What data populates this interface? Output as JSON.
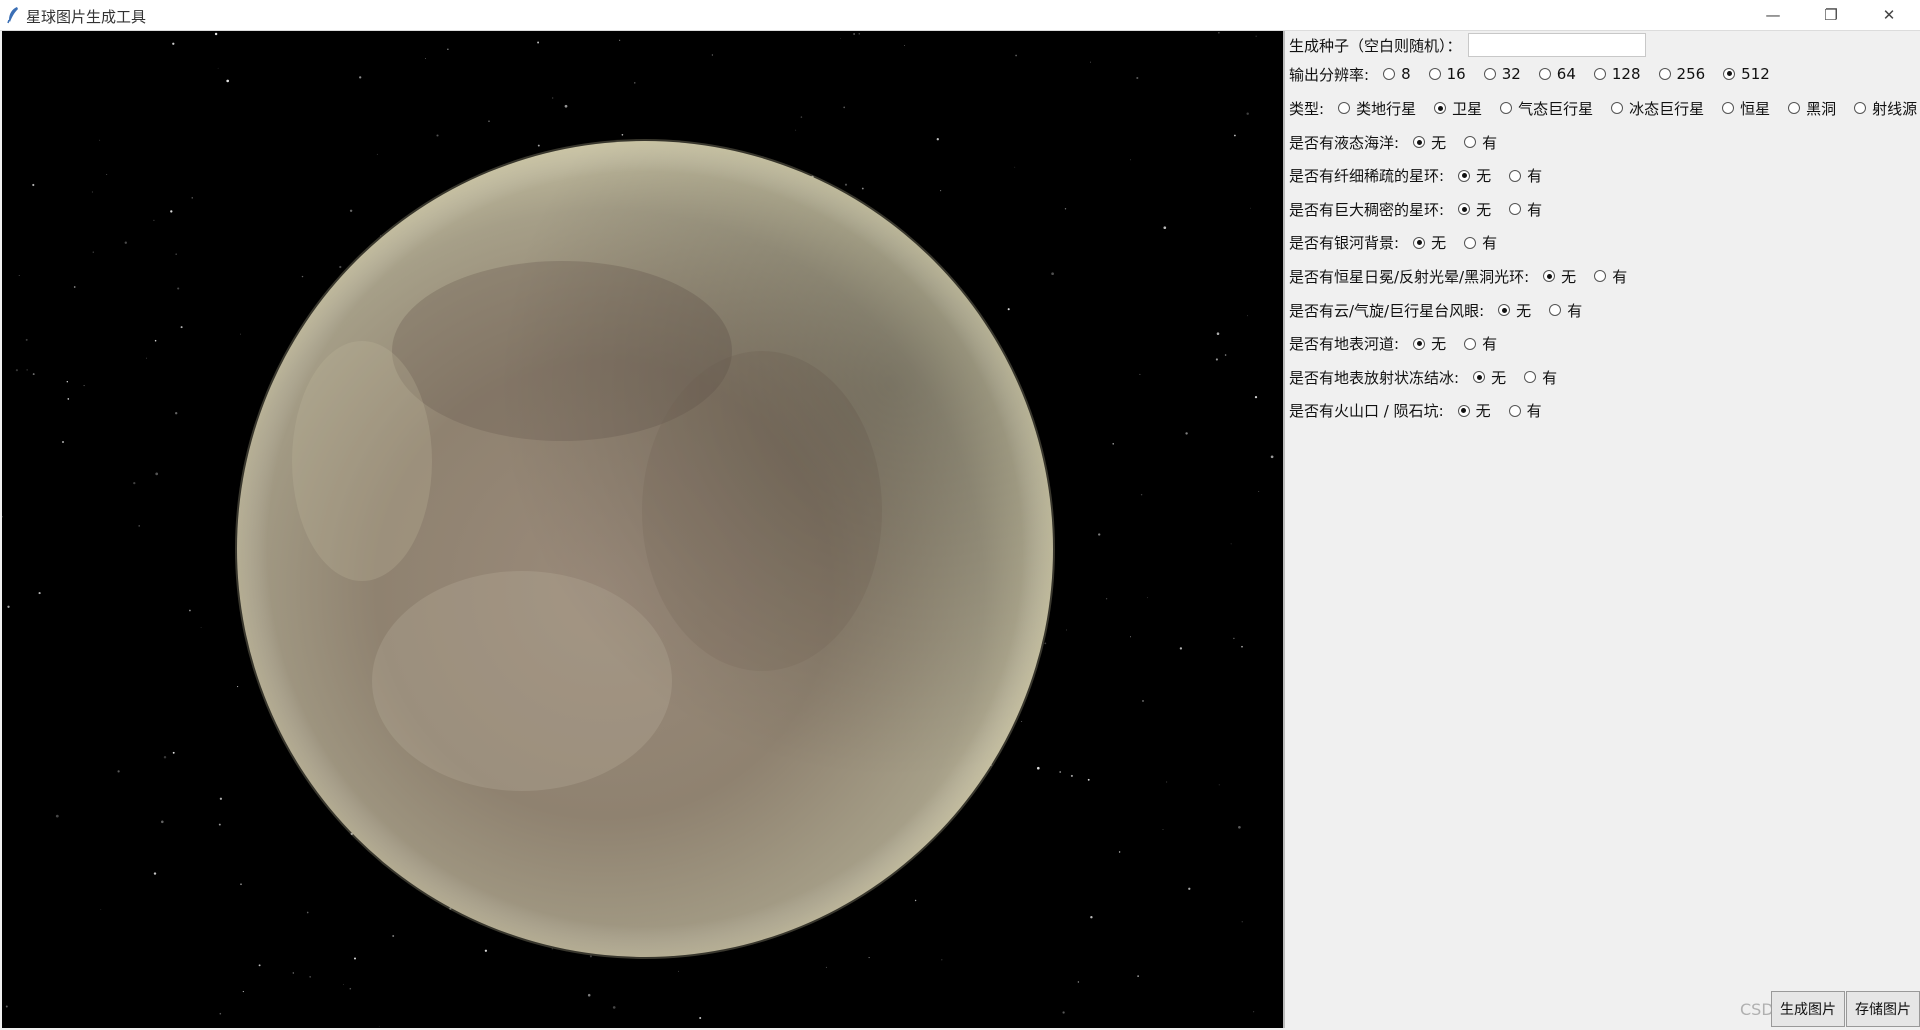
{
  "window": {
    "title": "星球图片生成工具"
  },
  "window_controls": {
    "minimize": "—",
    "maximize": "❐",
    "close": "✕"
  },
  "seed": {
    "label": "生成种子（空白则随机）：",
    "value": ""
  },
  "resolution": {
    "label": "输出分辨率:",
    "options": [
      "8",
      "16",
      "32",
      "64",
      "128",
      "256",
      "512"
    ],
    "selected": "512"
  },
  "type": {
    "label": "类型:",
    "options": [
      "类地行星",
      "卫星",
      "气态巨行星",
      "冰态巨行星",
      "恒星",
      "黑洞",
      "射线源"
    ],
    "selected": "卫星"
  },
  "options": [
    {
      "label": "是否有液态海洋:",
      "no": "无",
      "yes": "有",
      "selected": "无"
    },
    {
      "label": "是否有纤细稀疏的星环:",
      "no": "无",
      "yes": "有",
      "selected": "无"
    },
    {
      "label": "是否有巨大稠密的星环:",
      "no": "无",
      "yes": "有",
      "selected": "无"
    },
    {
      "label": "是否有银河背景:",
      "no": "无",
      "yes": "有",
      "selected": "无"
    },
    {
      "label": "是否有恒星日冕/反射光晕/黑洞光环:",
      "no": "无",
      "yes": "有",
      "selected": "无"
    },
    {
      "label": "是否有云/气旋/巨行星台风眼:",
      "no": "无",
      "yes": "有",
      "selected": "无"
    },
    {
      "label": "是否有地表河道:",
      "no": "无",
      "yes": "有",
      "selected": "无"
    },
    {
      "label": "是否有地表放射状冻结冰:",
      "no": "无",
      "yes": "有",
      "selected": "无"
    },
    {
      "label": "是否有火山口 / 陨石坑:",
      "no": "无",
      "yes": "有",
      "selected": "无"
    }
  ],
  "buttons": {
    "generate": "生成图片",
    "save": "存储图片"
  },
  "watermark": "CSDN @zhangmz",
  "colors": {
    "planet_light": "#c9c4a4",
    "planet_mid": "#8f8270",
    "planet_dark": "#5c5246",
    "space": "#000000"
  }
}
